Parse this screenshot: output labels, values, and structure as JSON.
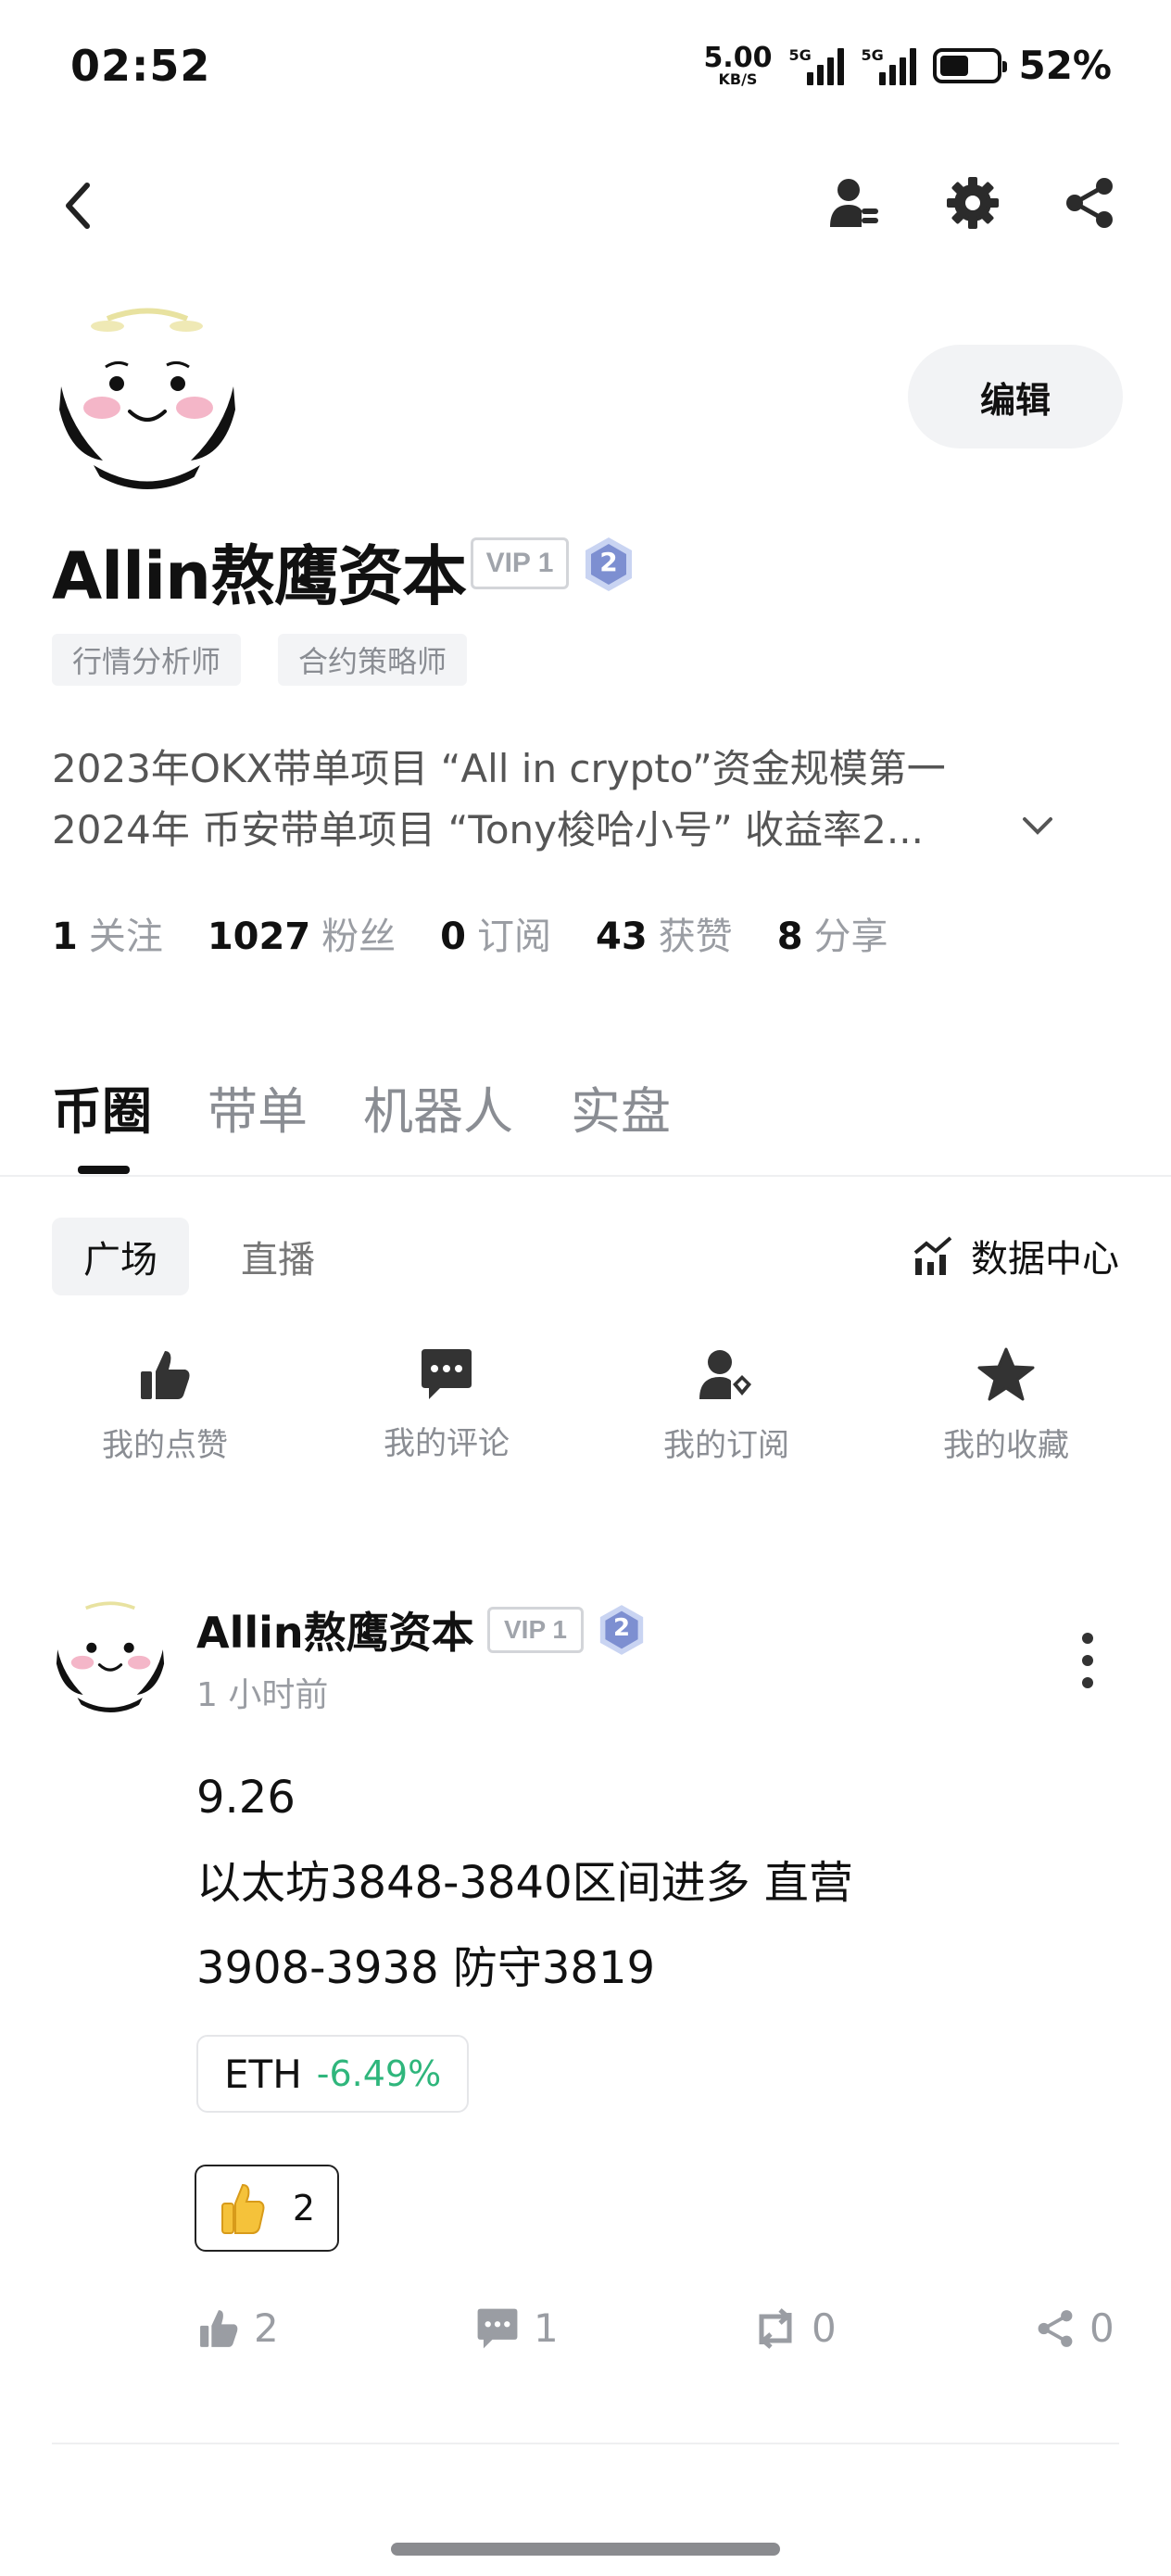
{
  "status_bar": {
    "time": "02:52",
    "net_speed": "5.00",
    "net_unit": "KB/S",
    "sim1_label": "5G",
    "sim2_label": "5G",
    "battery_level": 0.52,
    "battery_pct": "52%"
  },
  "nav": {
    "icons": [
      "back-icon",
      "user-settings-icon",
      "gear-icon",
      "share-icon"
    ]
  },
  "profile": {
    "name": "Allin熬鹰资本",
    "vip": "VIP 1",
    "level": "2",
    "edit_label": "编辑",
    "tags": [
      "行情分析师",
      "合约策略师"
    ],
    "bio_line1": "2023年OKX带单项目 “All in crypto”资金规模第一",
    "bio_line2": "2024年 币安带单项目 “Tony梭哈小号” 收益率2...",
    "stats": [
      {
        "value": "1",
        "label": "关注"
      },
      {
        "value": "1027",
        "label": "粉丝"
      },
      {
        "value": "0",
        "label": "订阅"
      },
      {
        "value": "43",
        "label": "获赞"
      },
      {
        "value": "8",
        "label": "分享"
      }
    ]
  },
  "tabs": {
    "main": [
      "币圈",
      "带单",
      "机器人",
      "实盘"
    ],
    "active_main": "币圈",
    "sub": [
      "广场",
      "直播"
    ],
    "active_sub": "广场",
    "data_center": "数据中心"
  },
  "quick_actions": [
    {
      "icon": "thumbs-up-icon",
      "label": "我的点赞"
    },
    {
      "icon": "comment-icon",
      "label": "我的评论"
    },
    {
      "icon": "subscription-icon",
      "label": "我的订阅"
    },
    {
      "icon": "star-icon",
      "label": "我的收藏"
    }
  ],
  "post": {
    "author": "Allin熬鹰资本",
    "vip": "VIP 1",
    "level": "2",
    "time": "1 小时前",
    "lines": [
      "9.26",
      "以太坊3848-3840区间进多 直营",
      "3908-3938 防守3819"
    ],
    "coin": "ETH",
    "coin_change": "-6.49%",
    "coin_change_color": "#2fb67c",
    "reaction_count": "2",
    "likes": "2",
    "comments": "1",
    "reposts": "0",
    "shares": "0"
  }
}
